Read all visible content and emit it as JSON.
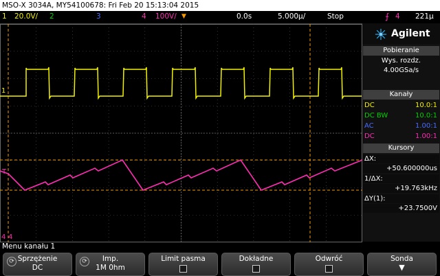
{
  "titlebar": {
    "text": "MSO-X 3034A, MY54100678: Fri Feb 20 15:13:04 2015"
  },
  "status": {
    "ch1_num": "1",
    "ch1_scale": "20.0V/",
    "ch2_num": "2",
    "ch3_num": "3",
    "ch4_num": "4",
    "ch4_scale": "100V/",
    "time_offset": "0.0s",
    "timebase": "5.000µ/",
    "run_state": "Stop",
    "trig_slope_icon": "rising-edge-icon",
    "trig_source": "4",
    "trig_level": "221µ"
  },
  "screen": {
    "ch1_ground_marker": "1",
    "ch4_ground_marker": "4",
    "trigger_marker": "T",
    "cursor_marker": "4"
  },
  "panel": {
    "logo": "Agilent",
    "acq_header": "Pobieranie",
    "acq_mode": "Wys. rozdz.",
    "acq_rate": "4.00GSa/s",
    "channels_header": "Kanały",
    "channels": [
      {
        "coupling": "DC",
        "probe": "10.0:1",
        "color": "#f2f200"
      },
      {
        "coupling": "DC BW",
        "probe": "10.0:1",
        "color": "#00d000"
      },
      {
        "coupling": "AC",
        "probe": "1.00:1",
        "color": "#4a6cff"
      },
      {
        "coupling": "DC",
        "probe": "1.00:1",
        "color": "#ff2db4"
      }
    ],
    "cursors_header": "Kursory",
    "dx_label": "ΔX:",
    "dx_value": "+50.600000us",
    "inv_dx_label": "1/ΔX:",
    "inv_dx_value": "+19.763kHz",
    "dy_label": "ΔY(1):",
    "dy_value": "+23.7500V"
  },
  "menu": {
    "label": "Menu  kanału 1",
    "keys": [
      {
        "line1": "Sprzężenie",
        "line2": "DC"
      },
      {
        "line1": "Imp.",
        "line2": "1M 0hm"
      },
      {
        "line1": "Limit pasma"
      },
      {
        "line1": "Dokładne"
      },
      {
        "line1": "Odwróć"
      },
      {
        "line1": "Sonda"
      }
    ]
  },
  "colors": {
    "ch1": "#f2f200",
    "ch2": "#00d000",
    "ch3": "#4a6cff",
    "ch4": "#ff2db4",
    "cursor": "#f39a00",
    "grid": "#5a5a5a"
  }
}
